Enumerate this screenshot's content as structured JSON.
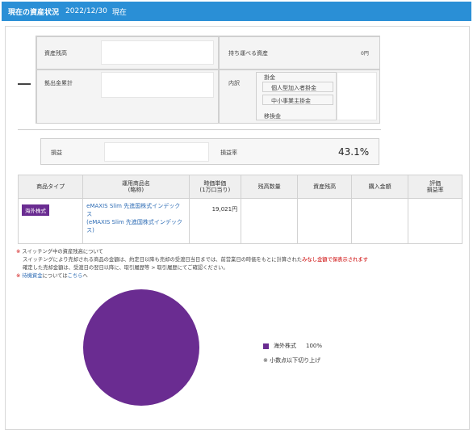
{
  "header": {
    "title": "現在の資産状況",
    "date": "2022/12/30",
    "now": "現在"
  },
  "assets": {
    "balance_label": "資産残高",
    "contribution_label": "拠出金累計",
    "portable_label": "持ち運べる資産",
    "portable_value": "0円",
    "breakdown_label": "内訳",
    "kakekin_label": "掛金",
    "individual_label": "個人型加入者掛金",
    "employer_label": "中小事業主掛金",
    "transfer_label": "移換金"
  },
  "profit": {
    "profit_label": "損益",
    "rate_label": "損益率",
    "rate_value": "43.1%"
  },
  "table": {
    "headers": [
      "商品タイプ",
      "運用商品名\n(略称)",
      "時価単価\n(1万口当り)",
      "残高数量",
      "資産残高",
      "購入金額",
      "評価\n損益率"
    ],
    "row": {
      "type": "海外株式",
      "name": "eMAXIS Slim 先進国株式インデックス\n(eMAXIS Slim 先進国株式インデックス)",
      "price": "19,021円"
    }
  },
  "notes": {
    "line1_mark": "※",
    "line1": "スイッチング中の資産残高について",
    "line2a": "スイッチングにより売却される商品の金額は、約定日以降も売却の受渡日当日までは、前営業日の時価をもとに計算された",
    "line2b": "みなし金額で保表示されます",
    "line3": "確定した売却金額は、受渡日の翌日以降に、取引履歴等 > 取引履歴にてご確認ください。",
    "line4_mark": "※",
    "line4a": "待機資金",
    "line4b": "については",
    "line4c": "こちら",
    "line4d": "へ"
  },
  "chart_data": {
    "type": "pie",
    "categories": [
      "海外株式"
    ],
    "values": [
      100
    ],
    "colors": [
      "#6a2c91"
    ],
    "legend_value": "100%",
    "footnote": "※ 小数点以下切り上げ"
  }
}
